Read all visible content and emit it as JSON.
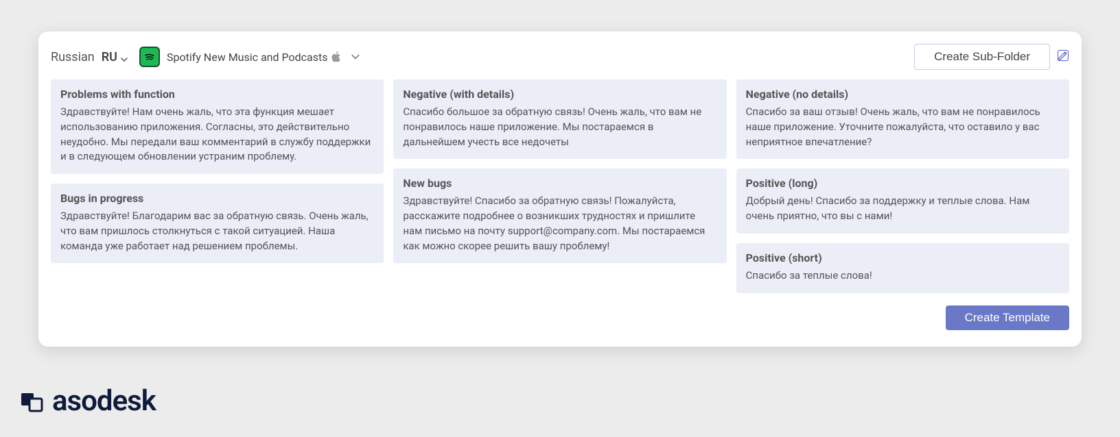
{
  "header": {
    "language_name": "Russian",
    "language_code": "RU",
    "app_name": "Spotify New Music and Podcasts",
    "create_subfolder_label": "Create Sub-Folder"
  },
  "columns": [
    [
      {
        "title": "Problems with function",
        "body": "Здравствуйте! Нам очень жаль, что эта функция мешает использованию приложения. Согласны, это действительно неудобно. Мы передали ваш комментарий в службу поддержки и в следующем обновлении устраним проблему."
      },
      {
        "title": "Bugs in progress",
        "body": "Здравствуйте! Благодарим вас за обратную связь. Очень жаль, что вам пришлось столкнуться с такой ситуацией. Наша команда уже работает над решением проблемы."
      }
    ],
    [
      {
        "title": "Negative (with details)",
        "body": "Спасибо большое за обратную связь! Очень жаль, что вам не понравилось наше приложение. Мы постараемся в дальнейшем учесть все недочеты"
      },
      {
        "title": "New bugs",
        "body": "Здравствуйте! Спасибо за обратную связь! Пожалуйста, расскажите подробнее о возникших трудностях и пришлите нам письмо на почту support@company.com. Мы постараемся как можно скорее решить вашу проблему!"
      }
    ],
    [
      {
        "title": "Negative (no details)",
        "body": "Спасибо за ваш отзыв! Очень жаль, что вам не понравилось наше приложение. Уточните пожалуйста, что оставило у вас неприятное впечатление?"
      },
      {
        "title": "Positive (long)",
        "body": "Добрый день! Спасибо за поддержку и теплые слова. Нам очень приятно, что вы с нами!"
      },
      {
        "title": "Positive (short)",
        "body": "Спасибо за теплые слова!"
      }
    ]
  ],
  "footer": {
    "create_template_label": "Create Template"
  },
  "brand": {
    "name": "asodesk"
  }
}
